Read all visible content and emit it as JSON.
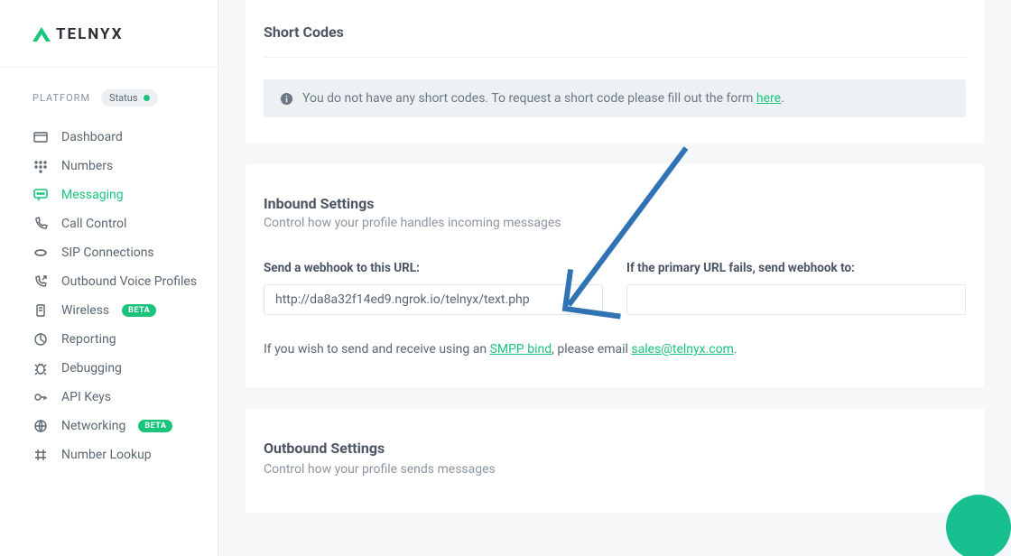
{
  "brand": {
    "name": "TELNYX"
  },
  "sidebar": {
    "section_label": "PLATFORM",
    "status_label": "Status",
    "items": [
      {
        "label": "Dashboard"
      },
      {
        "label": "Numbers"
      },
      {
        "label": "Messaging",
        "active": true
      },
      {
        "label": "Call Control"
      },
      {
        "label": "SIP Connections"
      },
      {
        "label": "Outbound Voice Profiles"
      },
      {
        "label": "Wireless",
        "badge": "BETA"
      },
      {
        "label": "Reporting"
      },
      {
        "label": "Debugging"
      },
      {
        "label": "API Keys"
      },
      {
        "label": "Networking",
        "badge": "BETA"
      },
      {
        "label": "Number Lookup"
      }
    ]
  },
  "short_codes": {
    "title": "Short Codes",
    "notice_prefix": "You do not have any short codes. To request a short code please fill out the form ",
    "notice_link_text": "here",
    "notice_suffix": "."
  },
  "inbound": {
    "title": "Inbound Settings",
    "subhead": "Control how your profile handles incoming messages",
    "webhook_label": "Send a webhook to this URL:",
    "webhook_value": "http://da8a32f14ed9.ngrok.io/telnyx/text.php",
    "failover_label": "If the primary URL fails, send webhook to:",
    "failover_value": "",
    "smpp_prefix": "If you wish to send and receive using an ",
    "smpp_link1": "SMPP bind",
    "smpp_mid": ", please email ",
    "smpp_link2": "sales@telnyx.com",
    "smpp_suffix": "."
  },
  "outbound": {
    "title": "Outbound Settings",
    "subhead": "Control how your profile sends messages"
  }
}
